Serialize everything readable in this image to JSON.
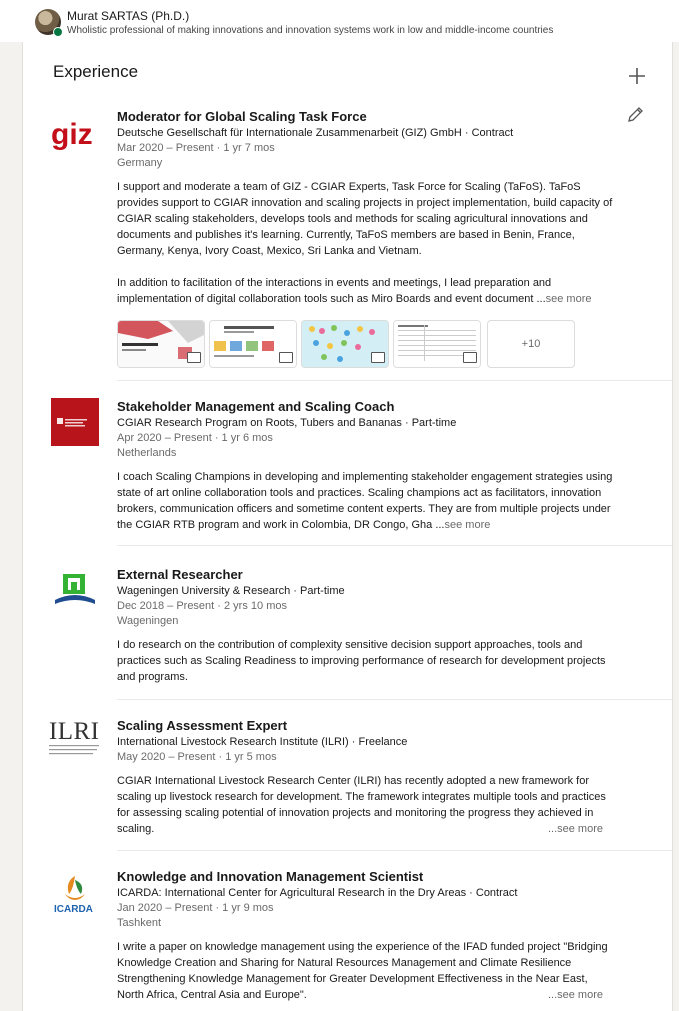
{
  "header": {
    "name": "Murat SARTAS (Ph.D.)",
    "headline": "Wholistic professional of making innovations and innovation systems work in low and middle-income countries"
  },
  "section": {
    "title": "Experience",
    "add_icon": "plus-icon",
    "edit_icon": "pencil-icon"
  },
  "colors": {
    "giz_red": "#c30f19",
    "cgiar_red": "#b8141c",
    "wur_green": "#34b233",
    "ilri_dark": "#333333",
    "icarda_orange": "#e58a1f",
    "icarda_green": "#2e8b3e",
    "icarda_blue": "#1f63ae"
  },
  "experiences": [
    {
      "logo_text": "giz",
      "title": "Moderator for Global Scaling Task Force",
      "company": "Deutsche Gesellschaft für Internationale Zusammenarbeit (GIZ) GmbH · Contract",
      "dates": "Mar 2020 – Present · 1 yr 7 mos",
      "location": "Germany",
      "description": "I support and moderate a team of GIZ - CGIAR Experts, Task Force for Scaling (TaFoS). TaFoS provides support to CGIAR innovation and scaling projects in project implementation, build capacity of CGIAR scaling stakeholders, develops tools and methods for scaling agricultural innovations and documents and publishes it's learning. Currently, TaFoS members are based in Benin, France, Germany, Kenya, Ivory Coast, Mexico, Sri Lanka and Vietnam.\n\nIn addition to facilitation of the interactions in events and meetings, I lead preparation and implementation of digital collaboration tools such as Miro Boards and event document ...",
      "see_more": "see more",
      "media_more": "+10"
    },
    {
      "title": "Stakeholder Management and Scaling Coach",
      "company": "CGIAR Research Program on Roots, Tubers and Bananas · Part-time",
      "dates": "Apr 2020 – Present · 1 yr 6 mos",
      "location": "Netherlands",
      "description": "I coach Scaling Champions in developing and implementing stakeholder engagement strategies using state of art online collaboration tools and practices. Scaling champions act as facilitators, innovation brokers, communication officers and sometime content experts. They are from multiple projects under the CGIAR RTB program and work in Colombia, DR Congo, Gha ...",
      "see_more": "see more"
    },
    {
      "title": "External Researcher",
      "company": "Wageningen University & Research · Part-time",
      "dates": "Dec 2018 – Present · 2 yrs 10 mos",
      "location": "Wageningen",
      "description": "I do research on the contribution of complexity sensitive decision support approaches, tools and practices such as Scaling Readiness to improving performance of research for development projects and programs."
    },
    {
      "logo_text": "ILRI",
      "logo_sub": "INTERNATIONAL LIVESTOCK RESEARCH INSTITUTE",
      "title": "Scaling Assessment Expert",
      "company": "International Livestock Research Institute (ILRI) · Freelance",
      "dates": "May 2020 – Present · 1 yr 5 mos",
      "description": "CGIAR International Livestock Research Center (ILRI) has recently adopted a new framework for scaling up livestock research for development.  The framework integrates multiple tools and practices for assessing scaling potential of innovation projects and monitoring the progress they achieved in scaling.",
      "see_more": "...see more"
    },
    {
      "logo_text": "ICARDA",
      "title": "Knowledge and Innovation Management Scientist",
      "company": "ICARDA: International Center for Agricultural Research in the Dry Areas · Contract",
      "dates": "Jan 2020 – Present · 1 yr 9 mos",
      "location": "Tashkent",
      "description": "I write a paper on knowledge management using the experience of the IFAD funded project \"Bridging Knowledge Creation and Sharing for Natural Resources Management and Climate Resilience Strengthening Knowledge Management for Greater Development Effectiveness in the Near East, North Africa, Central Asia and Europe\".",
      "see_more": "...see more"
    }
  ]
}
